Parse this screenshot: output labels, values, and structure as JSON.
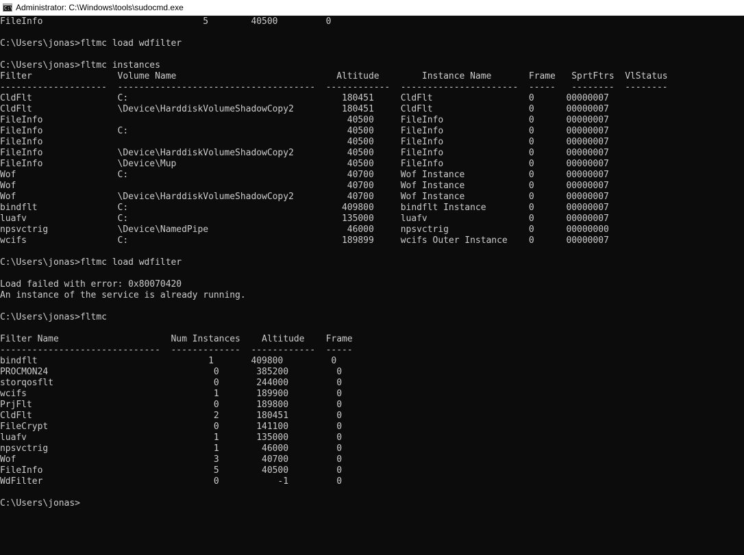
{
  "window": {
    "title": "Administrator: C:\\Windows\\tools\\sudocmd.exe",
    "icon": "console-icon",
    "text_color": "#cccccc",
    "background": "#0c0c0c"
  },
  "console": {
    "lines": [
      "FileInfo                              5        40500         0",
      "",
      "C:\\Users\\jonas>fltmc load wdfilter",
      "",
      "C:\\Users\\jonas>fltmc instances",
      "Filter                Volume Name                              Altitude        Instance Name       Frame   SprtFtrs  VlStatus",
      "--------------------  -------------------------------------  ------------  ----------------------  -----   --------  --------",
      "CldFlt                C:                                        180451     CldFlt                  0      00000007",
      "CldFlt                \\Device\\HarddiskVolumeShadowCopy2         180451     CldFlt                  0      00000007",
      "FileInfo                                                         40500     FileInfo                0      00000007",
      "FileInfo              C:                                         40500     FileInfo                0      00000007",
      "FileInfo                                                         40500     FileInfo                0      00000007",
      "FileInfo              \\Device\\HarddiskVolumeShadowCopy2          40500     FileInfo                0      00000007",
      "FileInfo              \\Device\\Mup                                40500     FileInfo                0      00000007",
      "Wof                   C:                                         40700     Wof Instance            0      00000007",
      "Wof                                                              40700     Wof Instance            0      00000007",
      "Wof                   \\Device\\HarddiskVolumeShadowCopy2          40700     Wof Instance            0      00000007",
      "bindflt               C:                                        409800     bindflt Instance        0      00000007",
      "luafv                 C:                                        135000     luafv                   0      00000007",
      "npsvctrig             \\Device\\NamedPipe                          46000     npsvctrig               0      00000000",
      "wcifs                 C:                                        189899     wcifs Outer Instance    0      00000007",
      "",
      "C:\\Users\\jonas>fltmc load wdfilter",
      "",
      "Load failed with error: 0x80070420",
      "An instance of the service is already running.",
      "",
      "C:\\Users\\jonas>fltmc",
      "",
      "Filter Name                     Num Instances    Altitude    Frame",
      "------------------------------  -------------  ------------  -----",
      "bindflt                                1       409800         0",
      "PROCMON24                               0       385200         0",
      "storqosflt                              0       244000         0",
      "wcifs                                   1       189900         0",
      "PrjFlt                                  0       189800         0",
      "CldFlt                                  2       180451         0",
      "FileCrypt                               0       141100         0",
      "luafv                                   1       135000         0",
      "npsvctrig                               1        46000         0",
      "Wof                                     3        40700         0",
      "FileInfo                                5        40500         0",
      "WdFilter                                0           -1         0",
      "",
      "C:\\Users\\jonas>"
    ]
  }
}
